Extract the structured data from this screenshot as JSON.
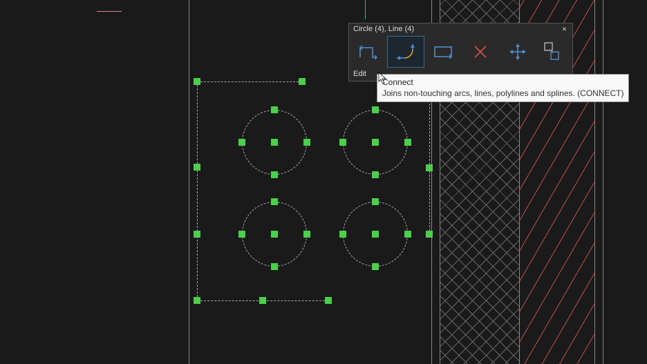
{
  "popup": {
    "title": "Circle (4), Line (4)",
    "close_glyph": "×",
    "footer_label": "Edit",
    "tools": {
      "open_polyline": "open-polyline-icon",
      "connect": "connect-arc-icon",
      "closed_polyline": "closed-polyline-icon",
      "delete": "delete-icon",
      "move": "move-icon",
      "explode": "explode-icon"
    }
  },
  "tooltip": {
    "title": "Connect",
    "description": "Joins non-touching arcs, lines, polylines and splines. (CONNECT)"
  },
  "colors": {
    "grip": "#4ad04a",
    "accent": "#4f8fd3",
    "delete": "#d05045"
  }
}
